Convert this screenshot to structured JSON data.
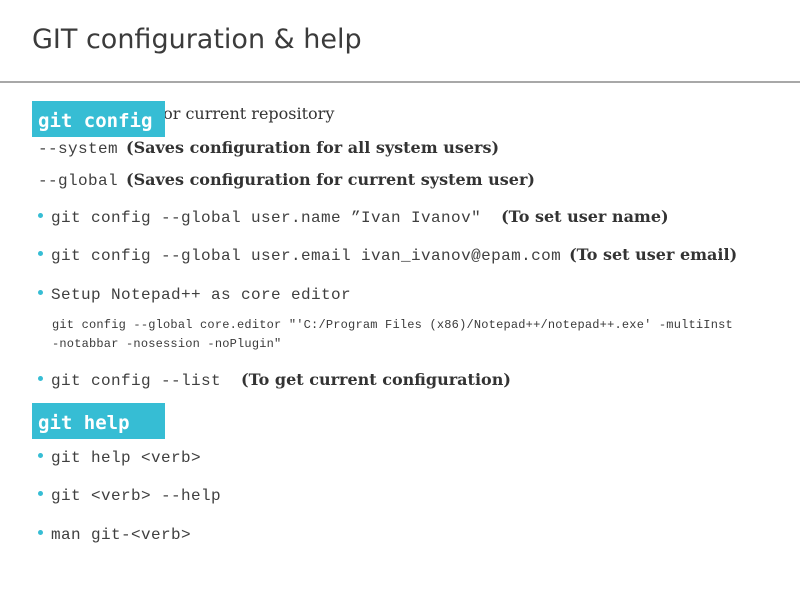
{
  "slide": {
    "title": "GIT configuration & help"
  },
  "config_section": {
    "badge": "git config",
    "intro_text": "Configuration for current repository",
    "options": [
      {
        "flag": "--system",
        "desc": "(Saves configuration for all system users)"
      },
      {
        "flag": "--global",
        "desc": "(Saves configuration for current system user)"
      }
    ],
    "bullets": [
      {
        "code": "git config --global user.name ”Ivan Ivanov\"",
        "desc": "(To set user name)"
      },
      {
        "code": "git config --global user.email ivan_ivanov@epam.com",
        "desc": "(To set user email)"
      },
      {
        "code": "Setup Notepad++ as core editor",
        "desc": ""
      },
      {
        "code": "git config --list",
        "desc": "(To get current configuration)"
      }
    ],
    "editor_command": {
      "line1": "git config --global core.editor \"'C:/Program Files (x86)/Notepad++/notepad++.exe' -multiInst",
      "line2": "-notabbar -nosession -noPlugin\""
    }
  },
  "help_section": {
    "badge": "git help",
    "bullets": [
      {
        "code": "git help <verb>"
      },
      {
        "code": "git <verb> --help"
      },
      {
        "code": "man git-<verb>"
      }
    ]
  },
  "colors": {
    "accent": "#36bdd4",
    "title": "#3b3b3b",
    "divider": "#a8a8a8"
  }
}
